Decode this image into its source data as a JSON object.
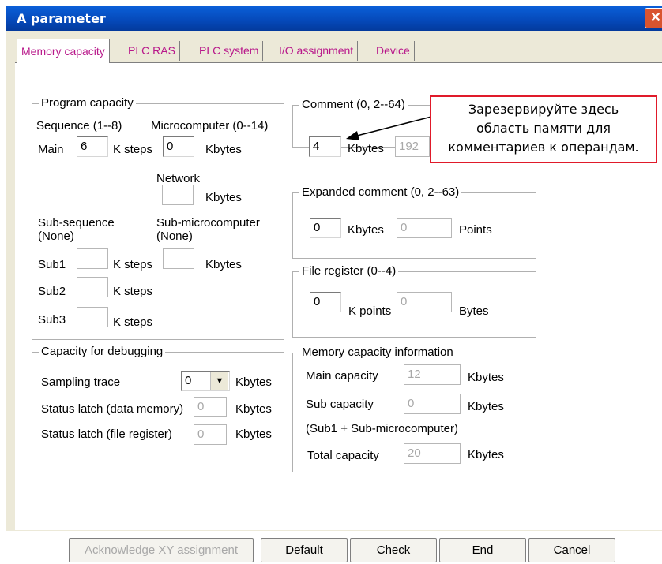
{
  "window": {
    "title": "A parameter",
    "close_glyph": "✕"
  },
  "tabs": [
    {
      "label": "Memory capacity",
      "active": true
    },
    {
      "label": "PLC RAS"
    },
    {
      "label": "PLC system"
    },
    {
      "label": "I/O assignment"
    },
    {
      "label": "Device"
    }
  ],
  "program_capacity": {
    "title": "Program capacity",
    "sequence_label": "Sequence (1--8)",
    "microcomputer_label": "Microcomputer (0--14)",
    "main_label": "Main",
    "main_value": "6",
    "k_steps": "K steps",
    "micro_value": "0",
    "kbytes": "Kbytes",
    "network_label": "Network",
    "network_value": "",
    "sub_sequence_label": "Sub-sequence",
    "sub_sequence_none": "(None)",
    "sub_micro_label": "Sub-microcomputer",
    "sub_micro_none": "(None)",
    "sub1": "Sub1",
    "sub2": "Sub2",
    "sub3": "Sub3"
  },
  "debug": {
    "title": "Capacity for debugging",
    "sampling_label": "Sampling trace",
    "sampling_value": "0",
    "status_data_label": "Status latch (data memory)",
    "status_data_value": "0",
    "status_file_label": "Status latch (file register)",
    "status_file_value": "0",
    "kbytes": "Kbytes"
  },
  "comment": {
    "title": "Comment (0, 2--64)",
    "value": "4",
    "kbytes": "Kbytes",
    "points_value": "192"
  },
  "expanded": {
    "title": "Expanded comment (0, 2--63)",
    "value": "0",
    "kbytes": "Kbytes",
    "points_value": "0",
    "points": "Points"
  },
  "file_register": {
    "title": "File register (0--4)",
    "value": "0",
    "k_points": "K points",
    "bytes_value": "0",
    "bytes": "Bytes"
  },
  "mem_info": {
    "title": "Memory capacity information",
    "main_label": "Main capacity",
    "main_value": "12",
    "sub_label": "Sub capacity",
    "sub_value": "0",
    "sub_note": "(Sub1 + Sub-microcomputer)",
    "total_label": "Total capacity",
    "total_value": "20",
    "kbytes": "Kbytes"
  },
  "callout": {
    "line1": "Зарезервируйте здесь",
    "line2": "область памяти для",
    "line3": "комментариев к операндам.",
    "border_color": "#e01a2a"
  },
  "buttons": {
    "ack": "Acknowledge XY assignment",
    "default": "Default",
    "check": "Check",
    "end": "End",
    "cancel": "Cancel"
  }
}
